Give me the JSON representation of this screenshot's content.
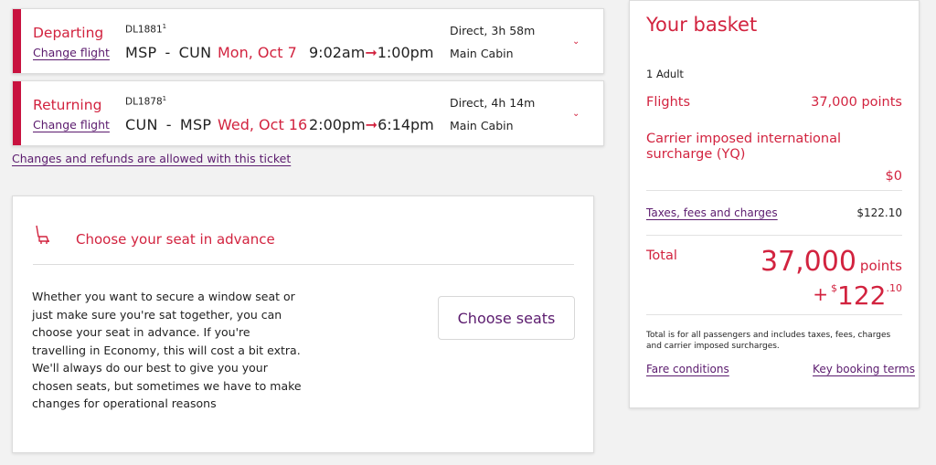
{
  "departing": {
    "label": "Departing",
    "change_link": "Change flight",
    "flight_number": "DL1881",
    "flight_sup": "1",
    "origin": "MSP",
    "separator": "-",
    "destination": "CUN",
    "date": "Mon, Oct 7",
    "depart_time": "9:02am",
    "arrive_time": "1:00pm",
    "duration": "Direct, 3h 58m",
    "cabin": "Main Cabin"
  },
  "returning": {
    "label": "Returning",
    "change_link": "Change flight",
    "flight_number": "DL1878",
    "flight_sup": "1",
    "origin": "CUN",
    "separator": "-",
    "destination": "MSP",
    "date": "Wed, Oct 16",
    "depart_time": "2:00pm",
    "arrive_time": "6:14pm",
    "duration": "Direct, 4h 14m",
    "cabin": "Main Cabin"
  },
  "arrow_glyph": "➞",
  "chevron_glyph": "⌄",
  "refund_link": "Changes and refunds are allowed with this ticket",
  "seat": {
    "title": "Choose your seat in advance",
    "description": "Whether you want to secure a window seat or just make sure you're sat together, you can choose your seat in advance. If you're travelling in Economy, this will cost a bit extra. We'll always do our best to give you your chosen seats, but sometimes we have to make changes for operational reasons",
    "button": "Choose seats"
  },
  "basket": {
    "title": "Your basket",
    "passengers": "1 Adult",
    "flights_label": "Flights",
    "flights_value": "37,000 points",
    "surcharge_label": "Carrier imposed international surcharge (YQ)",
    "surcharge_value": "$0",
    "taxes_label": "Taxes, fees and charges",
    "taxes_value": "$122.10",
    "total_label": "Total",
    "total_points": "37,000",
    "total_points_unit": "points",
    "plus": "+",
    "currency": "$",
    "total_cash_whole": "122",
    "total_cash_cents": ".10",
    "note": "Total is for all passengers and includes taxes, fees, charges and carrier imposed surcharges.",
    "fare_conditions": "Fare conditions",
    "key_terms": "Key booking terms"
  },
  "colors": {
    "accent_red": "#d2233f",
    "link_purple": "#5b1b6e",
    "bar_red": "#c8123f"
  }
}
